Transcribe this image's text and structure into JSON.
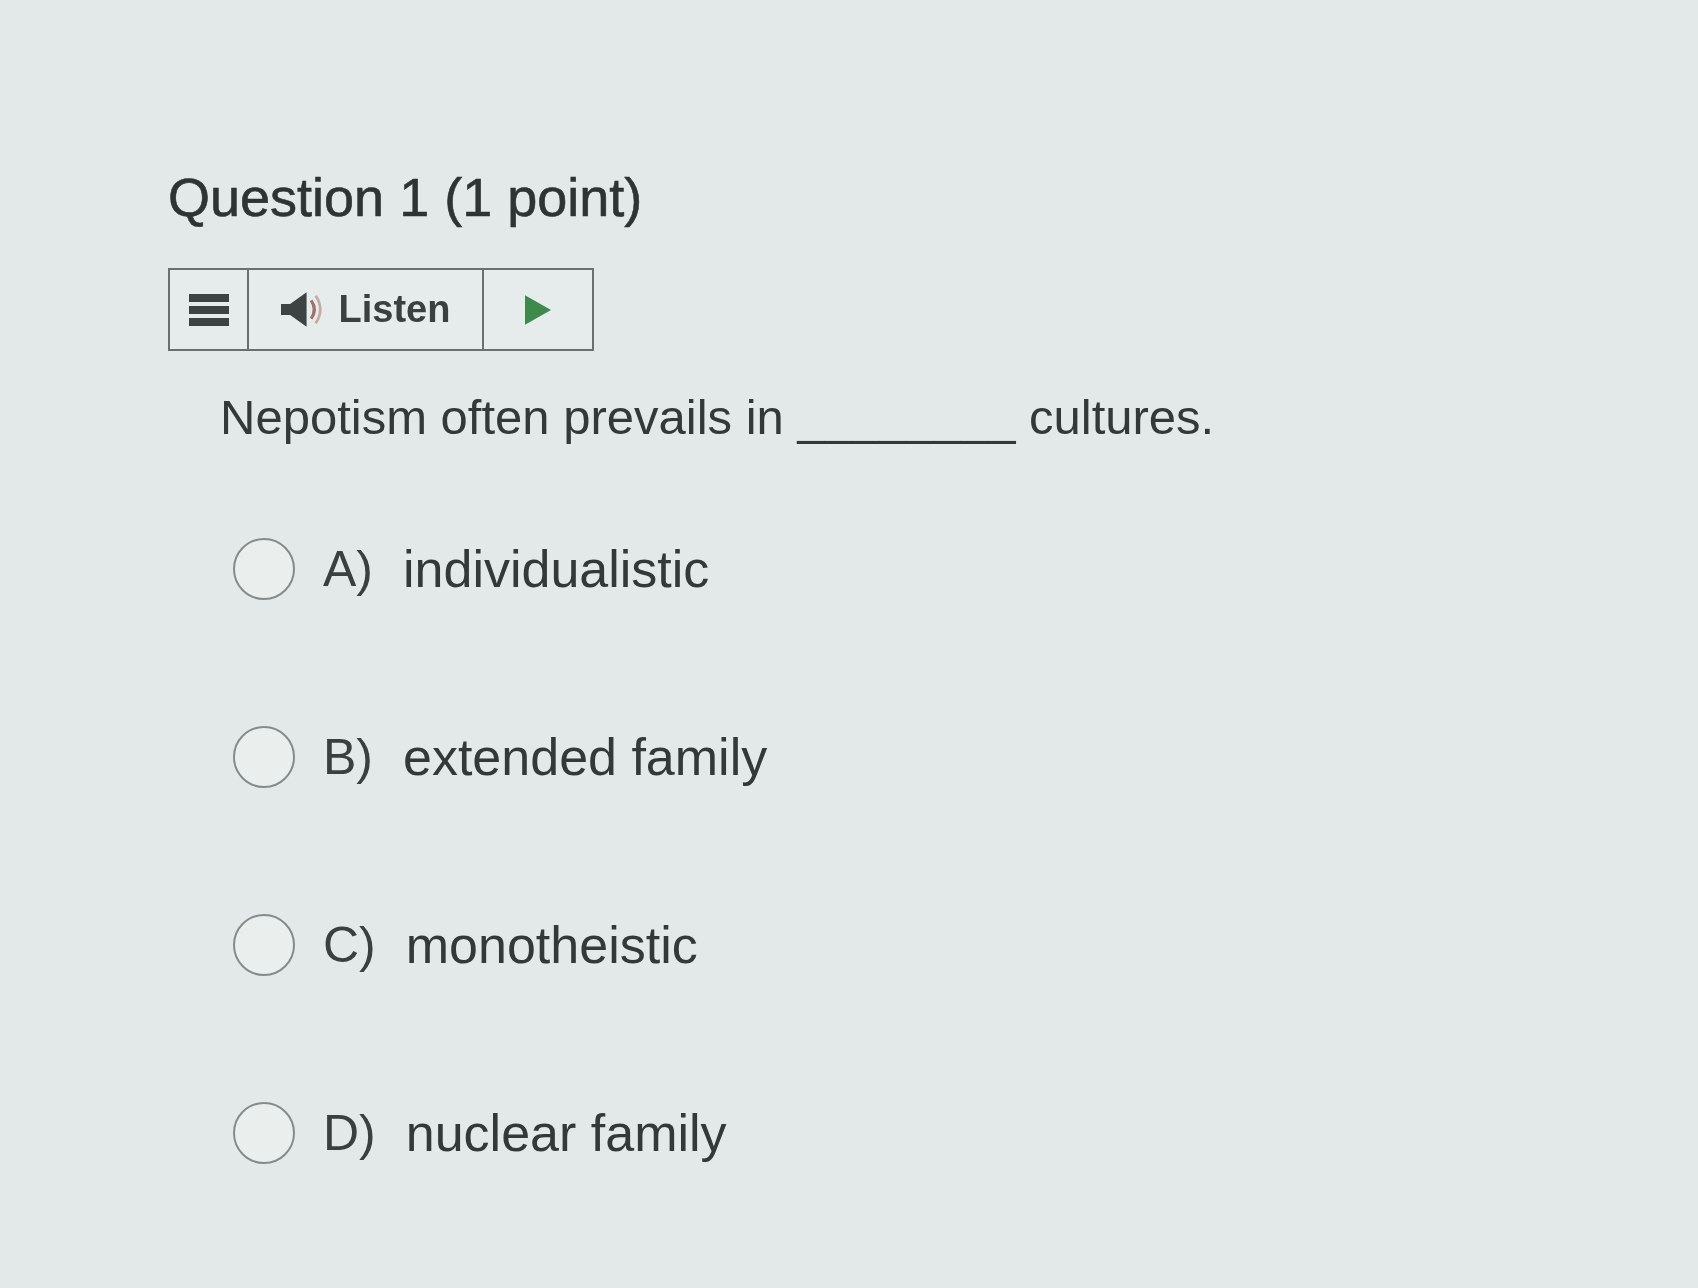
{
  "question": {
    "title": "Question 1 (1 point)",
    "toolbar": {
      "listen_label": "Listen"
    },
    "text": "Nepotism often prevails in ________ cultures.",
    "options": [
      {
        "letter": "A)",
        "text": "individualistic",
        "selected": false
      },
      {
        "letter": "B)",
        "text": "extended family",
        "selected": false
      },
      {
        "letter": "C)",
        "text": "monotheistic",
        "selected": false
      },
      {
        "letter": "D)",
        "text": "nuclear family",
        "selected": false
      }
    ]
  }
}
